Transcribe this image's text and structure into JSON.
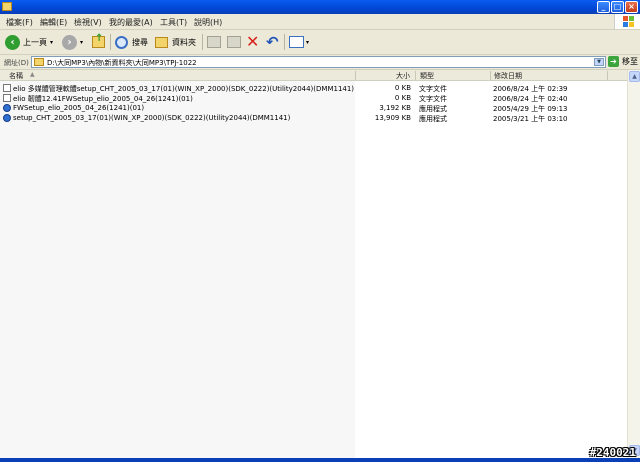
{
  "menu": [
    "檔案(F)",
    "編輯(E)",
    "檢視(V)",
    "我的最愛(A)",
    "工具(T)",
    "說明(H)"
  ],
  "toolbar": {
    "back_label": "上一頁",
    "search_label": "搜尋",
    "folders_label": "資料夾"
  },
  "address": {
    "label": "網址(D)",
    "path": "D:\\大同MP3\\內物\\新資料夾\\大同MP3\\TPJ-1022",
    "go_label": "移至"
  },
  "columns": {
    "name": "名稱",
    "size": "大小",
    "type": "類型",
    "modified": "修改日期"
  },
  "files": [
    {
      "name": "elio 多媒體管理軟體setup_CHT_2005_03_17(01)(WIN_XP_2000)(SDK_0222)(Utility2044)(DMM1141)",
      "size": "0 KB",
      "type": "文字文件",
      "modified": "2006/8/24 上午 02:39",
      "icon": "text-file-icon"
    },
    {
      "name": "elio 韌體12.41FWSetup_elio_2005_04_26(1241)(01)",
      "size": "0 KB",
      "type": "文字文件",
      "modified": "2006/8/24 上午 02:40",
      "icon": "text-file-icon"
    },
    {
      "name": "FWSetup_elio_2005_04_26(1241)(01)",
      "size": "3,192 KB",
      "type": "應用程式",
      "modified": "2005/4/29 上午 09:13",
      "icon": "application-icon"
    },
    {
      "name": "setup_CHT_2005_03_17(01)(WIN_XP_2000)(SDK_0222)(Utility2044)(DMM1141)",
      "size": "13,909 KB",
      "type": "應用程式",
      "modified": "2005/3/21 上午 03:10",
      "icon": "application-icon"
    }
  ],
  "watermark": "#240021"
}
